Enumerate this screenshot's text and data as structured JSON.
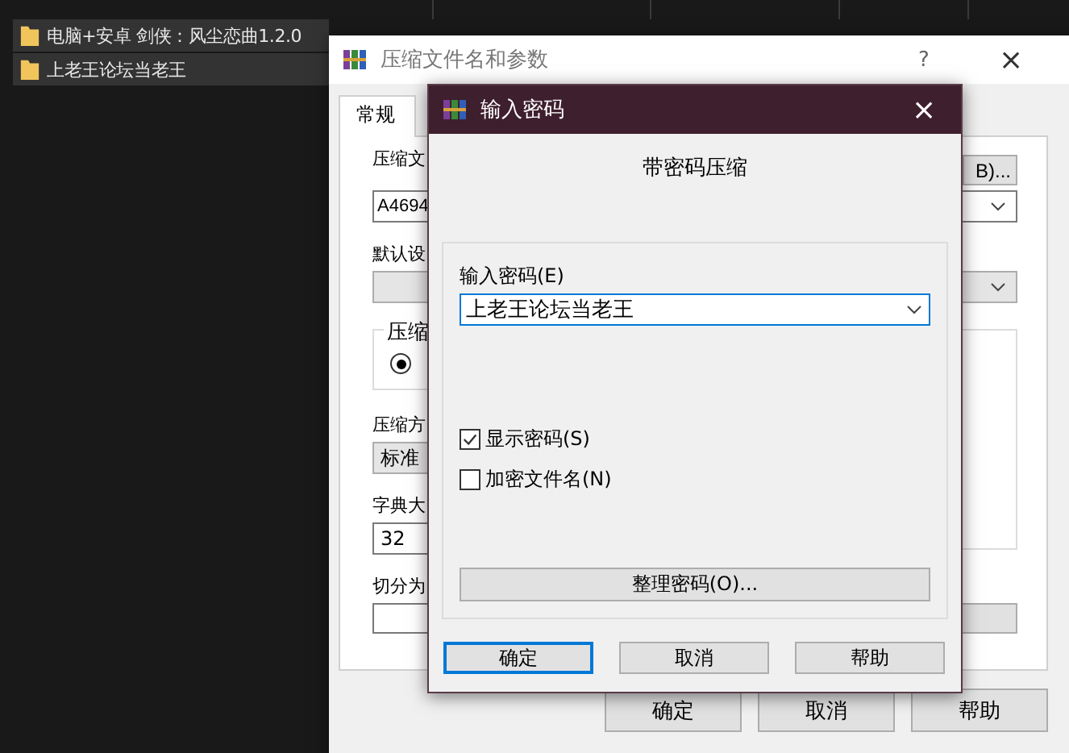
{
  "explorer": {
    "items": [
      {
        "name": "电脑+安卓 剑侠：风尘恋曲1.2.0",
        "selected": true
      },
      {
        "name": "上老王论坛当老王",
        "selected": true
      }
    ]
  },
  "archive_dialog": {
    "title": "压缩文件名和参数",
    "help": "?",
    "close": "×",
    "tabs": [
      {
        "label": "常规",
        "selected": true
      }
    ],
    "archive_name_label": "压缩文",
    "browse_button": "B)...",
    "archive_name_value": "A4694",
    "profile_label": "默认设",
    "group_label": "压缩",
    "radio": {
      "selected": true
    },
    "method_label": "压缩方",
    "method_value": "标准",
    "dict_label": "字典大",
    "dict_value": "32",
    "split_label": "切分为",
    "buttons": [
      {
        "label": "确定",
        "default": false
      },
      {
        "label": "取消",
        "default": false
      },
      {
        "label": "帮助",
        "default": false
      }
    ]
  },
  "password_dialog": {
    "title": "输入密码",
    "close": "×",
    "subtitle": "带密码压缩",
    "password_label": "输入密码(E)",
    "password_value": "上老王论坛当老王",
    "options": [
      {
        "label": "显示密码(S)",
        "checked": true
      },
      {
        "label": "加密文件名(N)",
        "checked": false
      }
    ],
    "organize_button": "整理密码(O)...",
    "buttons": [
      {
        "label": "确定",
        "default": true
      },
      {
        "label": "取消",
        "default": false
      },
      {
        "label": "帮助",
        "default": false
      }
    ]
  }
}
